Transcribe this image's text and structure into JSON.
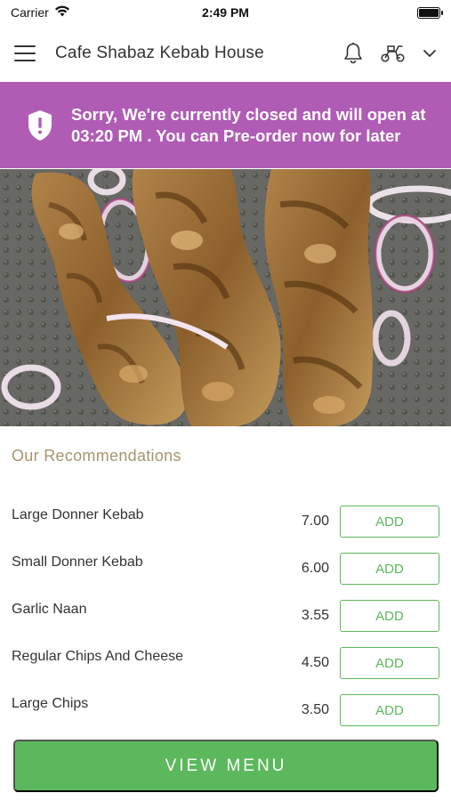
{
  "status_bar": {
    "carrier": "Carrier",
    "time": "2:49 PM"
  },
  "header": {
    "title": "Cafe Shabaz Kebab House",
    "icons": [
      "hamburger-menu-icon",
      "bell-icon",
      "scooter-icon",
      "chevron-down-icon"
    ]
  },
  "banner": {
    "message": "Sorry, We're currently closed and will open at 03:20 PM . You can Pre-order now for later",
    "icon": "shield-alert-icon",
    "color": "#b05cb5"
  },
  "hero": {
    "image": "grilled-chicken-kebab-skewers-photo"
  },
  "recommendations": {
    "title": "Our Recommendations",
    "items": [
      {
        "name": "Large Donner Kebab",
        "price": "7.00",
        "action": "ADD"
      },
      {
        "name": "Small Donner Kebab",
        "price": "6.00",
        "action": "ADD"
      },
      {
        "name": "Garlic Naan",
        "price": "3.55",
        "action": "ADD"
      },
      {
        "name": "Regular Chips And Cheese",
        "price": "4.50",
        "action": "ADD"
      },
      {
        "name": "Large Chips",
        "price": "3.50",
        "action": "ADD"
      }
    ]
  },
  "footer": {
    "view_menu_label": "VIEW MENU",
    "accent_color": "#5cb85c"
  }
}
